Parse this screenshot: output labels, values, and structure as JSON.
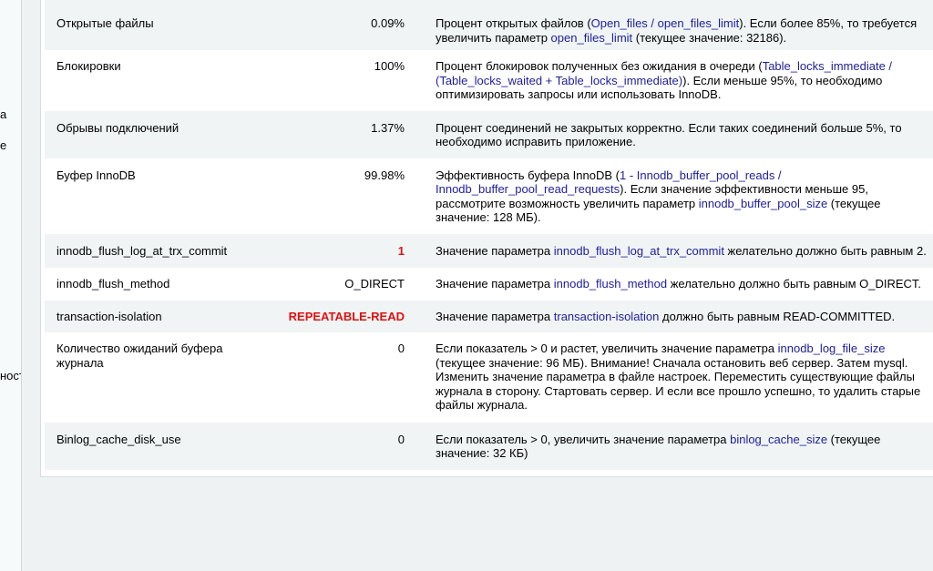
{
  "left_panel_fragments": [
    "а",
    "е",
    "ност"
  ],
  "rows": [
    {
      "name": "Открытые файлы",
      "value": "0.09%",
      "status": "ok",
      "desc": [
        {
          "t": "Процент открытых файлов ("
        },
        {
          "t": "Open_files / open_files_limit",
          "p": true
        },
        {
          "t": "). Если более 85%, то требуется увеличить параметр "
        },
        {
          "t": "open_files_limit",
          "p": true
        },
        {
          "t": " (текущее значение: 32186)."
        }
      ]
    },
    {
      "name": "Блокировки",
      "value": "100%",
      "status": "ok",
      "desc": [
        {
          "t": "Процент блокировок полученных без ожидания в очереди ("
        },
        {
          "t": "Table_locks_immediate / (Table_locks_waited + Table_locks_immediate)",
          "p": true
        },
        {
          "t": "). Если меньше 95%, то необходимо оптимизировать запросы или использовать InnoDB."
        }
      ]
    },
    {
      "name": "Обрывы подключений",
      "value": "1.37%",
      "status": "ok",
      "desc": [
        {
          "t": "Процент соединений не закрытых корректно. Если таких соединений больше 5%, то необходимо исправить приложение."
        }
      ]
    },
    {
      "name": "Буфер InnoDB",
      "value": "99.98%",
      "status": "ok",
      "desc": [
        {
          "t": "Эффективность буфера InnoDB ("
        },
        {
          "t": "1 - Innodb_buffer_pool_reads / Innodb_buffer_pool_read_requests",
          "p": true
        },
        {
          "t": "). Если значение эффективности меньше 95, рассмотрите возможность увеличить параметр "
        },
        {
          "t": "innodb_buffer_pool_size",
          "p": true
        },
        {
          "t": " (текущее значение: 128 МБ)."
        }
      ]
    },
    {
      "name": "innodb_flush_log_at_trx_commit",
      "value": "1",
      "status": "bad",
      "desc": [
        {
          "t": "Значение параметра "
        },
        {
          "t": "innodb_flush_log_at_trx_commit",
          "p": true
        },
        {
          "t": " желательно должно быть равным 2."
        }
      ]
    },
    {
      "name": "innodb_flush_method",
      "value": "O_DIRECT",
      "status": "ok",
      "desc": [
        {
          "t": "Значение параметра "
        },
        {
          "t": "innodb_flush_method",
          "p": true
        },
        {
          "t": " желательно должно быть равным O_DIRECT."
        }
      ]
    },
    {
      "name": "transaction-isolation",
      "value": "REPEATABLE-READ",
      "status": "bad",
      "desc": [
        {
          "t": "Значение параметра "
        },
        {
          "t": "transaction-isolation",
          "p": true
        },
        {
          "t": " должно быть равным READ-COMMITTED."
        }
      ]
    },
    {
      "name": "Количество ожиданий буфера журнала",
      "value": "0",
      "status": "ok",
      "desc": [
        {
          "t": "Если показатель > 0 и растет, увеличить значение параметра "
        },
        {
          "t": "innodb_log_file_size",
          "p": true
        },
        {
          "t": " (текущее значение: 96 МБ). Внимание! Сначала остановить веб сервер. Затем mysql. Изменить значение параметра в файле настроек. Переместить существующие файлы журнала в сторону. Стартовать сервер. И если все прошло успешно, то удалить старые файлы журнала."
        }
      ]
    },
    {
      "name": "Binlog_cache_disk_use",
      "value": "0",
      "status": "ok",
      "desc": [
        {
          "t": "Если показатель > 0, увеличить значение параметра "
        },
        {
          "t": "binlog_cache_size",
          "p": true
        },
        {
          "t": " (текущее значение: 32 КБ)"
        }
      ]
    }
  ]
}
